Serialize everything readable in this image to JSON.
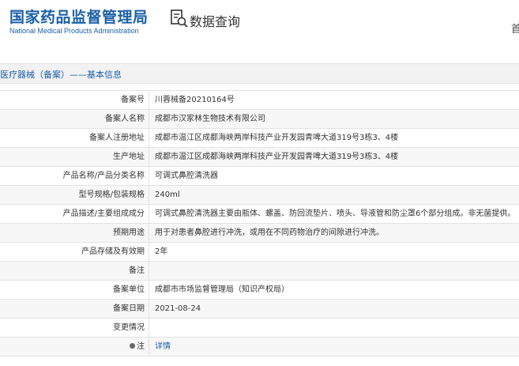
{
  "header": {
    "logo_cn": "国家药品监督管理局",
    "logo_en": "National Medical Products Administration",
    "query_title": "数据查询",
    "cut_char": "首"
  },
  "section": {
    "title": "医疗器械（备案）——基本信息"
  },
  "rows": [
    {
      "label": "备案号",
      "value": "川蓉械备20210164号"
    },
    {
      "label": "备案人名称",
      "value": "成都市汉家林生物技术有限公司"
    },
    {
      "label": "备案人注册地址",
      "value": "成都市温江区成都海峡两岸科技产业开发园青啤大道319号3栋3、4楼"
    },
    {
      "label": "生产地址",
      "value": "成都市温江区成都海峡两岸科技产业开发园青啤大道319号3栋3、4楼"
    },
    {
      "label": "产品名称/产品分类名称",
      "value": "可调式鼻腔清洗器"
    },
    {
      "label": "型号规格/包装规格",
      "value": "240ml"
    },
    {
      "label": "产品描述/主要组成成分",
      "value": "可调式鼻腔清洗器主要由瓶体、螺盖、防回流垫片、喷头、导液管和防尘罩6个部分组成。非无菌提供。"
    },
    {
      "label": "预期用途",
      "value": "用于对患者鼻腔进行冲洗，或用在不同药物治疗的间隙进行冲洗。"
    },
    {
      "label": "产品存储及有效期",
      "value": "2年"
    },
    {
      "label": "备注",
      "value": ""
    },
    {
      "label": "备案单位",
      "value": "成都市市场监督管理局（知识产权局）"
    },
    {
      "label": "备案日期",
      "value": "2021-08-24"
    },
    {
      "label": "变更情况",
      "value": ""
    },
    {
      "label": "注",
      "value": "详情"
    }
  ]
}
